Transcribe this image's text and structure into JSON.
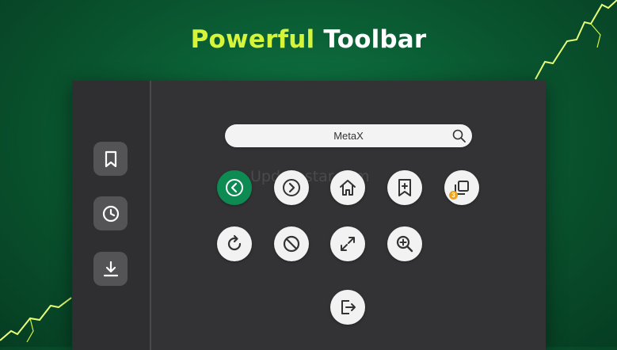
{
  "headline": {
    "accent": "Powerful",
    "rest": " Toolbar"
  },
  "search": {
    "value": "MetaX",
    "icon": "search-icon"
  },
  "watermark": "Updatestar.com",
  "colors": {
    "background": "#0a5a32",
    "accent": "#d4f53a",
    "panel": "#333335",
    "active_tool": "#0e8a53",
    "badge": "#f0a31a"
  },
  "sidebar": {
    "items": [
      {
        "icon": "bookmark-icon"
      },
      {
        "icon": "history-icon"
      },
      {
        "icon": "download-icon"
      }
    ]
  },
  "toolbar": {
    "tools": [
      {
        "icon": "back-icon",
        "active": true
      },
      {
        "icon": "forward-icon"
      },
      {
        "icon": "home-icon"
      },
      {
        "icon": "add-bookmark-icon"
      },
      {
        "icon": "tabs-icon",
        "badge": "3"
      },
      {
        "icon": "refresh-icon"
      },
      {
        "icon": "block-icon"
      },
      {
        "icon": "fullscreen-icon"
      },
      {
        "icon": "zoom-in-icon"
      },
      {
        "icon": "exit-icon"
      }
    ]
  }
}
